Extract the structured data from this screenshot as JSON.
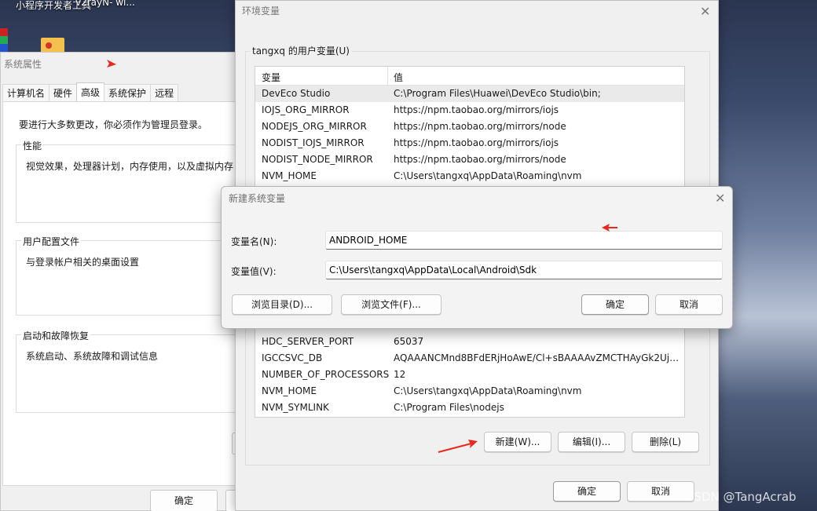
{
  "desktop": {
    "icon_label": "小程序开发者工具",
    "icon_label2": "v2rayN- wi..."
  },
  "sysprops": {
    "title": "系统属性",
    "tabs": [
      "计算机名",
      "硬件",
      "高级",
      "系统保护",
      "远程"
    ],
    "active_tab": "高级",
    "admin_note": "要进行大多数更改，你必须作为管理员登录。",
    "groups": [
      {
        "title": "性能",
        "desc": "视觉效果，处理器计划，内存使用，以及虚拟内存"
      },
      {
        "title": "用户配置文件",
        "desc": "与登录帐户相关的桌面设置"
      },
      {
        "title": "启动和故障恢复",
        "desc": "系统启动、系统故障和调试信息"
      }
    ],
    "ok_label": "确定"
  },
  "env": {
    "title": "环境变量",
    "user_group_title": "tangxq 的用户变量(U)",
    "col_name": "变量",
    "col_value": "值",
    "rows_top": [
      {
        "name": "DevEco Studio",
        "value": "C:\\Program Files\\Huawei\\DevEco Studio\\bin;"
      },
      {
        "name": "IOJS_ORG_MIRROR",
        "value": "https://npm.taobao.org/mirrors/iojs"
      },
      {
        "name": "NODEJS_ORG_MIRROR",
        "value": "https://npm.taobao.org/mirrors/node"
      },
      {
        "name": "NODIST_IOJS_MIRROR",
        "value": "https://npm.taobao.org/mirrors/iojs"
      },
      {
        "name": "NODIST_NODE_MIRROR",
        "value": "https://npm.taobao.org/mirrors/node"
      },
      {
        "name": "NVM_HOME",
        "value": "C:\\Users\\tangxq\\AppData\\Roaming\\nvm"
      }
    ],
    "rows_bottom": [
      {
        "name": "HDC_SERVER_PORT",
        "value": "65037"
      },
      {
        "name": "IGCCSVC_DB",
        "value": "AQAAANCMnd8BFdERjHoAwE/Cl+sBAAAAvZMCTHAyGk2Ujul..."
      },
      {
        "name": "NUMBER_OF_PROCESSORS",
        "value": "12"
      },
      {
        "name": "NVM_HOME",
        "value": "C:\\Users\\tangxq\\AppData\\Roaming\\nvm"
      },
      {
        "name": "NVM_SYMLINK",
        "value": "C:\\Program Files\\nodejs"
      }
    ],
    "btn_new": "新建(W)...",
    "btn_edit": "编辑(I)...",
    "btn_delete": "删除(L)",
    "btn_ok": "确定",
    "btn_cancel": "取消"
  },
  "new_var_dialog": {
    "title": "新建系统变量",
    "name_label": "变量名(N):",
    "name_value": "ANDROID_HOME",
    "value_label": "变量值(V):",
    "value_value": "C:\\Users\\tangxq\\AppData\\Local\\Android\\Sdk",
    "browse_dir": "浏览目录(D)...",
    "browse_file": "浏览文件(F)...",
    "ok": "确定",
    "cancel": "取消"
  },
  "colors": {
    "annotation_arrow": "#e8291c"
  },
  "watermark": "CSDN @TangAcrab"
}
